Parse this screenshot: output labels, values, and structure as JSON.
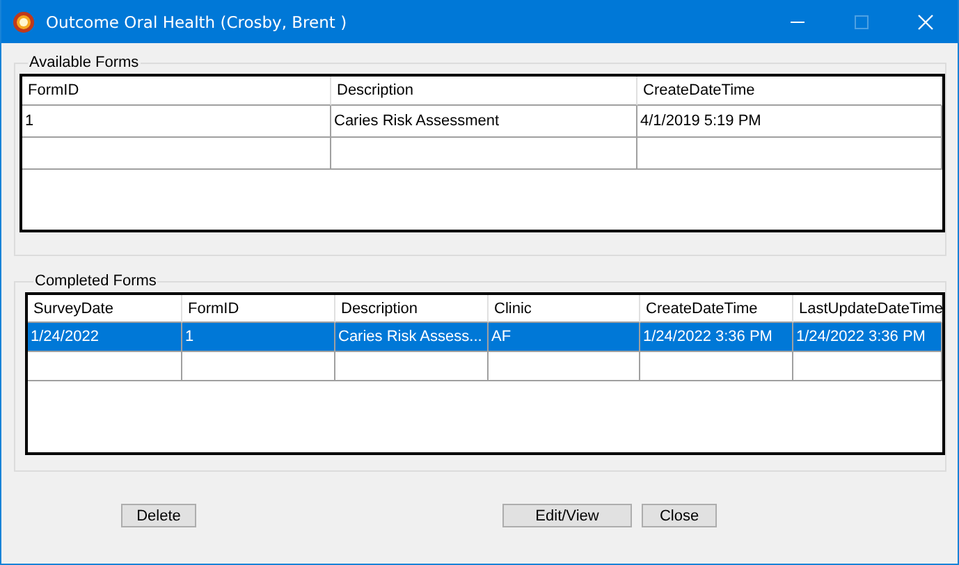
{
  "window": {
    "title": "Outcome Oral Health (Crosby, Brent )",
    "maximize_disabled": true
  },
  "available_forms": {
    "title": "Available Forms",
    "columns": [
      "FormID",
      "Description",
      "CreateDateTime"
    ],
    "rows": [
      {
        "cells": [
          "1",
          "Caries Risk Assessment",
          "4/1/2019 5:19 PM"
        ],
        "selected": false
      }
    ]
  },
  "completed_forms": {
    "title": "Completed Forms",
    "columns": [
      "SurveyDate",
      "FormID",
      "Description",
      "Clinic",
      "CreateDateTime",
      "LastUpdateDateTime"
    ],
    "rows": [
      {
        "cells": [
          "1/24/2022",
          "1",
          "Caries Risk Assess...",
          "AF",
          "1/24/2022 3:36 PM",
          "1/24/2022 3:36 PM"
        ],
        "selected": true
      }
    ]
  },
  "buttons": [
    {
      "label": "Delete",
      "kind": "left"
    },
    {
      "label": "Edit/View",
      "kind": "right"
    },
    {
      "label": "Close",
      "kind": "right"
    }
  ]
}
